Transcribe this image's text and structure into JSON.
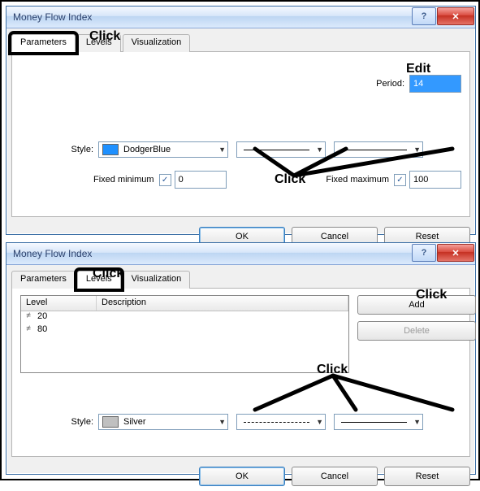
{
  "dialog1": {
    "title": "Money Flow Index",
    "tabs": [
      "Parameters",
      "Levels",
      "Visualization"
    ],
    "period_label": "Period:",
    "period_value": "14",
    "style_label": "Style:",
    "color_name": "DodgerBlue",
    "color_hex": "#1e90ff",
    "fixed_min_label": "Fixed minimum",
    "fixed_min_checked": "✓",
    "fixed_min_value": "0",
    "fixed_max_label": "Fixed maximum",
    "fixed_max_checked": "✓",
    "fixed_max_value": "100",
    "ok": "OK",
    "cancel": "Cancel",
    "reset": "Reset"
  },
  "dialog2": {
    "title": "Money Flow Index",
    "tabs": [
      "Parameters",
      "Levels",
      "Visualization"
    ],
    "col_level": "Level",
    "col_desc": "Description",
    "rows": [
      {
        "level": "20",
        "desc": ""
      },
      {
        "level": "80",
        "desc": ""
      }
    ],
    "add": "Add",
    "delete": "Delete",
    "style_label": "Style:",
    "color_name": "Silver",
    "color_hex": "#c0c0c0",
    "ok": "OK",
    "cancel": "Cancel",
    "reset": "Reset"
  },
  "annotations": {
    "click": "Click",
    "edit": "Edit"
  }
}
